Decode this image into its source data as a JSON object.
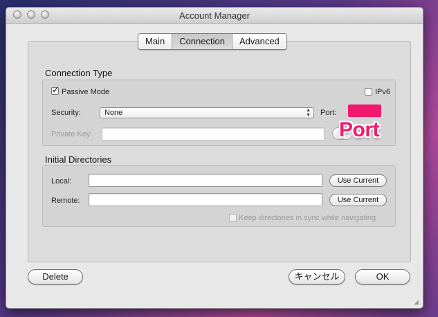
{
  "window": {
    "title": "Account Manager"
  },
  "tabs": [
    {
      "label": "Main",
      "active": false
    },
    {
      "label": "Connection",
      "active": true
    },
    {
      "label": "Advanced",
      "active": false
    }
  ],
  "connection_type": {
    "heading": "Connection Type",
    "passive_mode": {
      "label": "Passive Mode",
      "checked": true
    },
    "ipv6": {
      "label": "IPv6",
      "checked": false
    },
    "security": {
      "label": "Security:",
      "value": "None"
    },
    "port": {
      "label": "Port:",
      "overlay_text": "Port",
      "highlight_color": "#f0196e"
    },
    "private_key": {
      "label": "Private Key:",
      "value": ""
    }
  },
  "initial_directories": {
    "heading": "Initial Directories",
    "local": {
      "label": "Local:",
      "value": "",
      "button": "Use Current"
    },
    "remote": {
      "label": "Remote:",
      "value": "",
      "button": "Use Current"
    },
    "keep_in_sync": {
      "label": "Keep directories in sync while navigating",
      "checked": false
    }
  },
  "buttons": {
    "delete": "Delete",
    "cancel": "キャンセル",
    "ok": "OK"
  }
}
